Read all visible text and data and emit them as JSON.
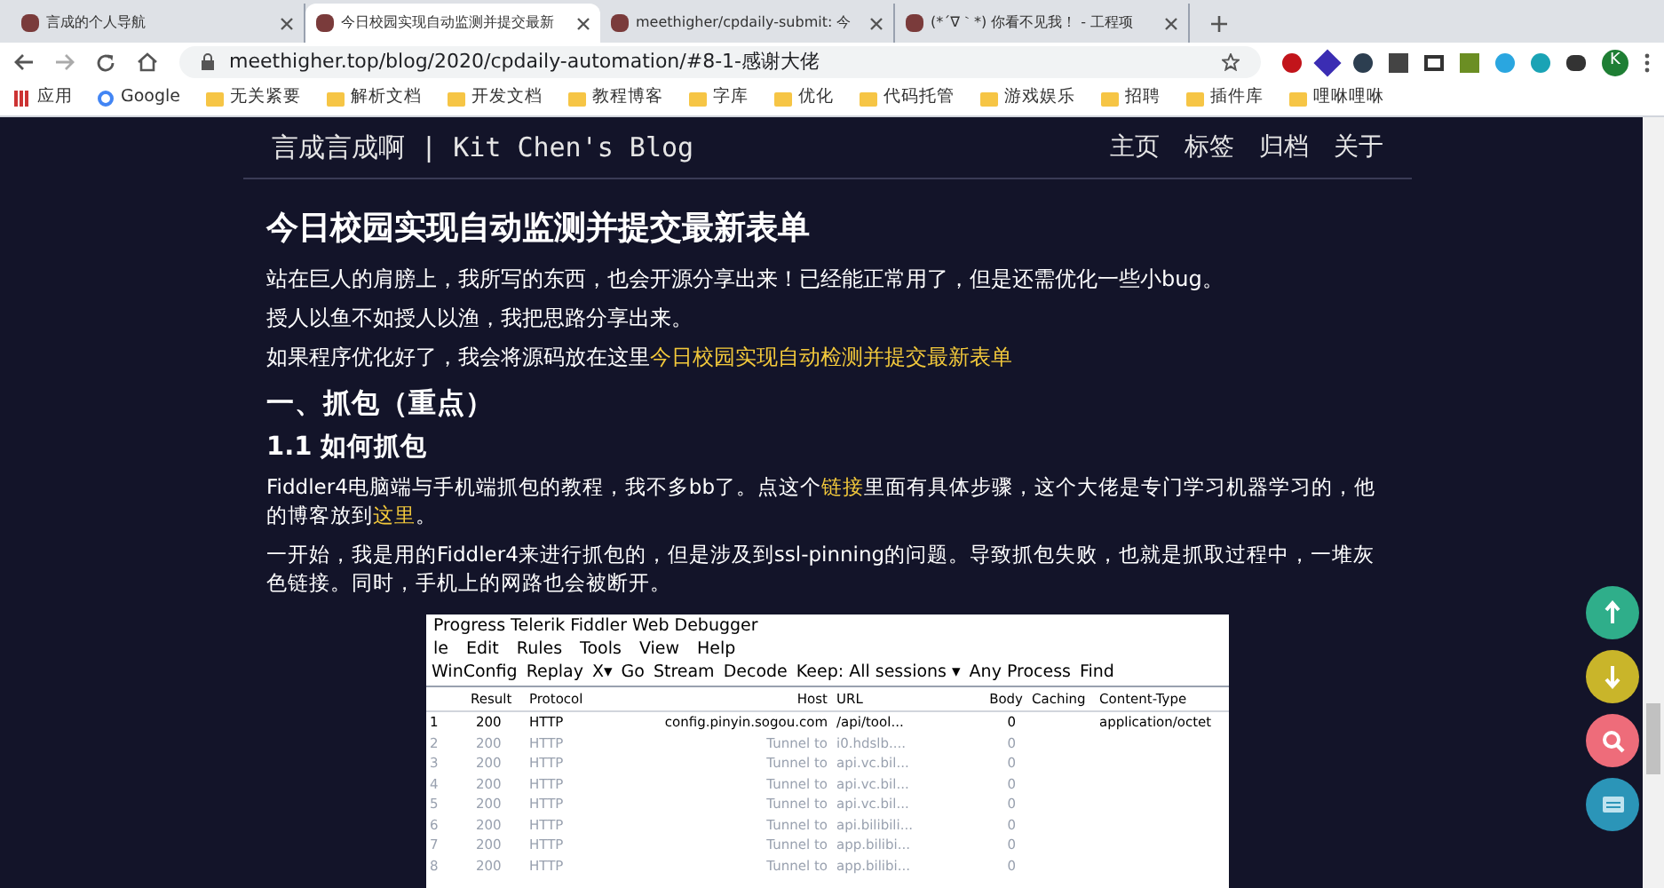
{
  "tabs": [
    {
      "title": "言成的个人导航",
      "selected": false
    },
    {
      "title": "今日校园实现自动监测并提交最新",
      "selected": true
    },
    {
      "title": "meethigher/cpdaily-submit: 今",
      "selected": false
    },
    {
      "title": "(*´∇｀*) 你看不见我！ - 工程项",
      "selected": false
    }
  ],
  "address_bar": {
    "url": "meethigher.top/blog/2020/cpdaily-automation/#8-1-感谢大佬"
  },
  "profile": {
    "initial": "K"
  },
  "bookmarks": [
    "应用",
    "Google",
    "无关紧要",
    "解析文档",
    "开发文档",
    "教程博客",
    "字库",
    "优化",
    "代码托管",
    "游戏娱乐",
    "招聘",
    "插件库",
    "哩咻哩咻"
  ],
  "site": {
    "title": "言成言成啊 | Kit Chen's Blog",
    "nav": [
      "主页",
      "标签",
      "归档",
      "关于"
    ]
  },
  "article": {
    "title": "今日校园实现自动监测并提交最新表单",
    "intro": [
      "站在巨人的肩膀上，我所写的东西，也会开源分享出来！已经能正常用了，但是还需优化一些小bug。",
      "授人以鱼不如授人以渔，我把思路分享出来。"
    ],
    "source_line": {
      "text": "如果程序优化好了，我会将源码放在这里",
      "link": "今日校园实现自动检测并提交最新表单"
    },
    "h2": "一、抓包（重点）",
    "h3": "1.1 如何抓包",
    "p1": {
      "before": "Fiddler4电脑端与手机端抓包的教程，我不多bb了。点这个",
      "link1": "链接",
      "middle": "里面有具体步骤，这个大佬是专门学习机器学习的，他的博客放到",
      "link2": "这里",
      "after": "。"
    },
    "p2": "一开始，我是用的Fiddler4来进行抓包的，但是涉及到ssl-pinning的问题。导致抓包失败，也就是抓取过程中，一堆灰色链接。同时，手机上的网路也会被断开。"
  },
  "fiddler": {
    "title": "Progress Telerik Fiddler Web Debugger",
    "menu": [
      "le",
      "Edit",
      "Rules",
      "Tools",
      "View",
      "Help"
    ],
    "toolbar": [
      "WinConfig",
      "Replay",
      "X▾",
      "Go",
      "Stream",
      "Decode",
      "Keep: All sessions ▾",
      "Any Process",
      "Find"
    ],
    "columns": [
      "Result",
      "Protocol",
      "Host",
      "URL",
      "Body",
      "Caching",
      "Content-Type"
    ],
    "rows": [
      {
        "number": "1",
        "result": "200",
        "protocol": "HTTP",
        "host": "config.pinyin.sogou.com",
        "url": "/api/tool...",
        "body": "0",
        "content_type": "application/octet",
        "dimmed": false
      },
      {
        "number": "2",
        "result": "200",
        "protocol": "HTTP",
        "host": "Tunnel to",
        "url": "i0.hdslb....",
        "body": "0",
        "dimmed": true
      },
      {
        "number": "3",
        "result": "200",
        "protocol": "HTTP",
        "host": "Tunnel to",
        "url": "api.vc.bil...",
        "body": "0",
        "dimmed": true
      },
      {
        "number": "4",
        "result": "200",
        "protocol": "HTTP",
        "host": "Tunnel to",
        "url": "api.vc.bil...",
        "body": "0",
        "dimmed": true
      },
      {
        "number": "5",
        "result": "200",
        "protocol": "HTTP",
        "host": "Tunnel to",
        "url": "api.vc.bil...",
        "body": "0",
        "dimmed": true
      },
      {
        "number": "6",
        "result": "200",
        "protocol": "HTTP",
        "host": "Tunnel to",
        "url": "api.bilibili...",
        "body": "0",
        "dimmed": true
      },
      {
        "number": "7",
        "result": "200",
        "protocol": "HTTP",
        "host": "Tunnel to",
        "url": "app.bilibi...",
        "body": "0",
        "dimmed": true
      },
      {
        "number": "8",
        "result": "200",
        "protocol": "HTTP",
        "host": "Tunnel to",
        "url": "app.bilibi...",
        "body": "0",
        "dimmed": true
      }
    ]
  },
  "float_buttons": [
    {
      "kind": "up",
      "color": "#2fae8a"
    },
    {
      "kind": "down",
      "color": "#c9b52a"
    },
    {
      "kind": "search",
      "color": "#ee6c7a"
    },
    {
      "kind": "reader",
      "color": "#2b95b8"
    }
  ]
}
